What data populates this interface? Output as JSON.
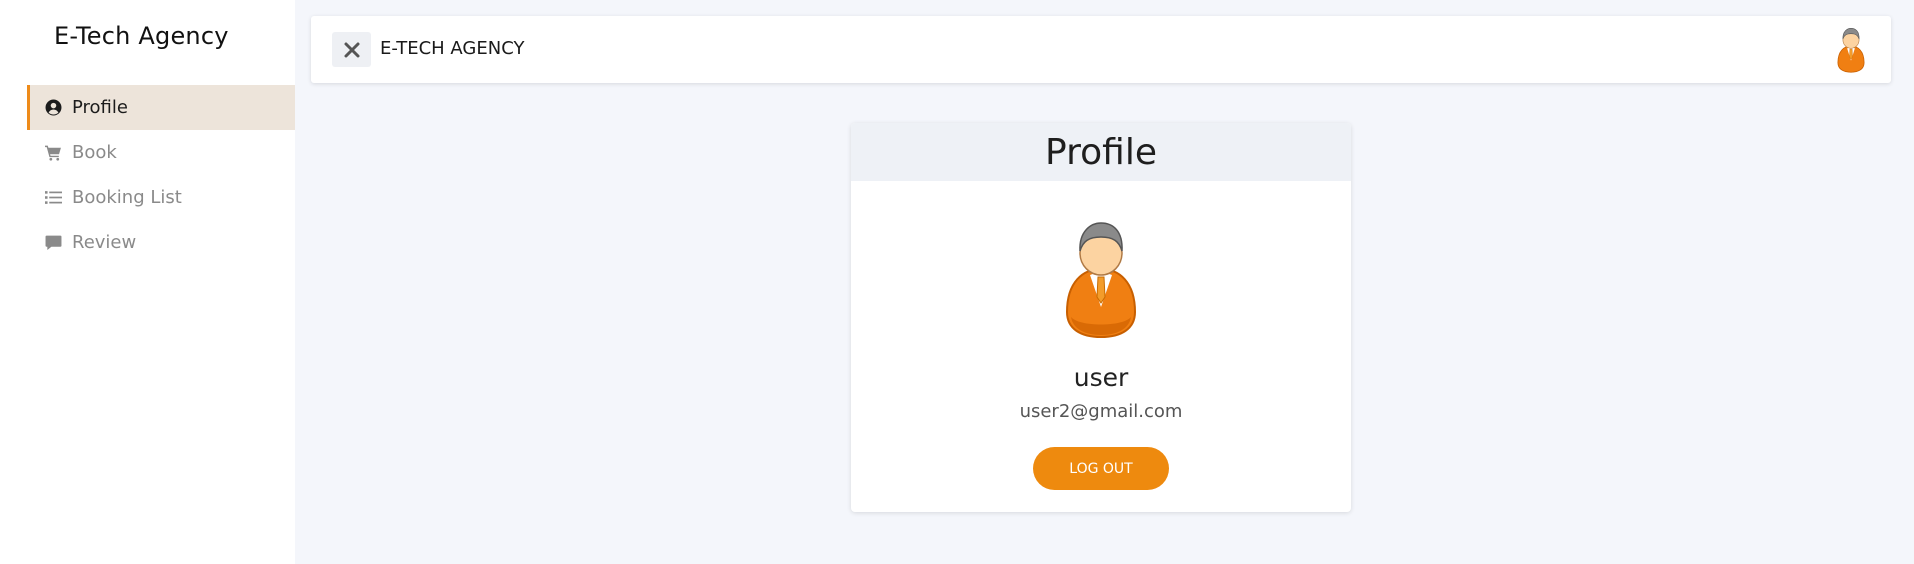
{
  "brand": {
    "name": "E-Tech Agency"
  },
  "sidebar": {
    "items": [
      {
        "label": "Profile",
        "icon": "user-circle-icon",
        "active": true
      },
      {
        "label": "Book",
        "icon": "cart-icon",
        "active": false
      },
      {
        "label": "Booking List",
        "icon": "list-icon",
        "active": false
      },
      {
        "label": "Review",
        "icon": "comment-icon",
        "active": false
      }
    ]
  },
  "topbar": {
    "toggle_icon": "close-icon",
    "title": "E-TECH AGENCY",
    "avatar_icon": "user-avatar-icon"
  },
  "profile": {
    "heading": "Profile",
    "username": "user",
    "email": "user2@gmail.com",
    "logout_label": "LOG OUT"
  },
  "colors": {
    "accent": "#ee8a0e",
    "active_nav_bg": "#ede4da",
    "page_bg": "#f4f6fb",
    "card_header_bg": "#eef1f6"
  }
}
